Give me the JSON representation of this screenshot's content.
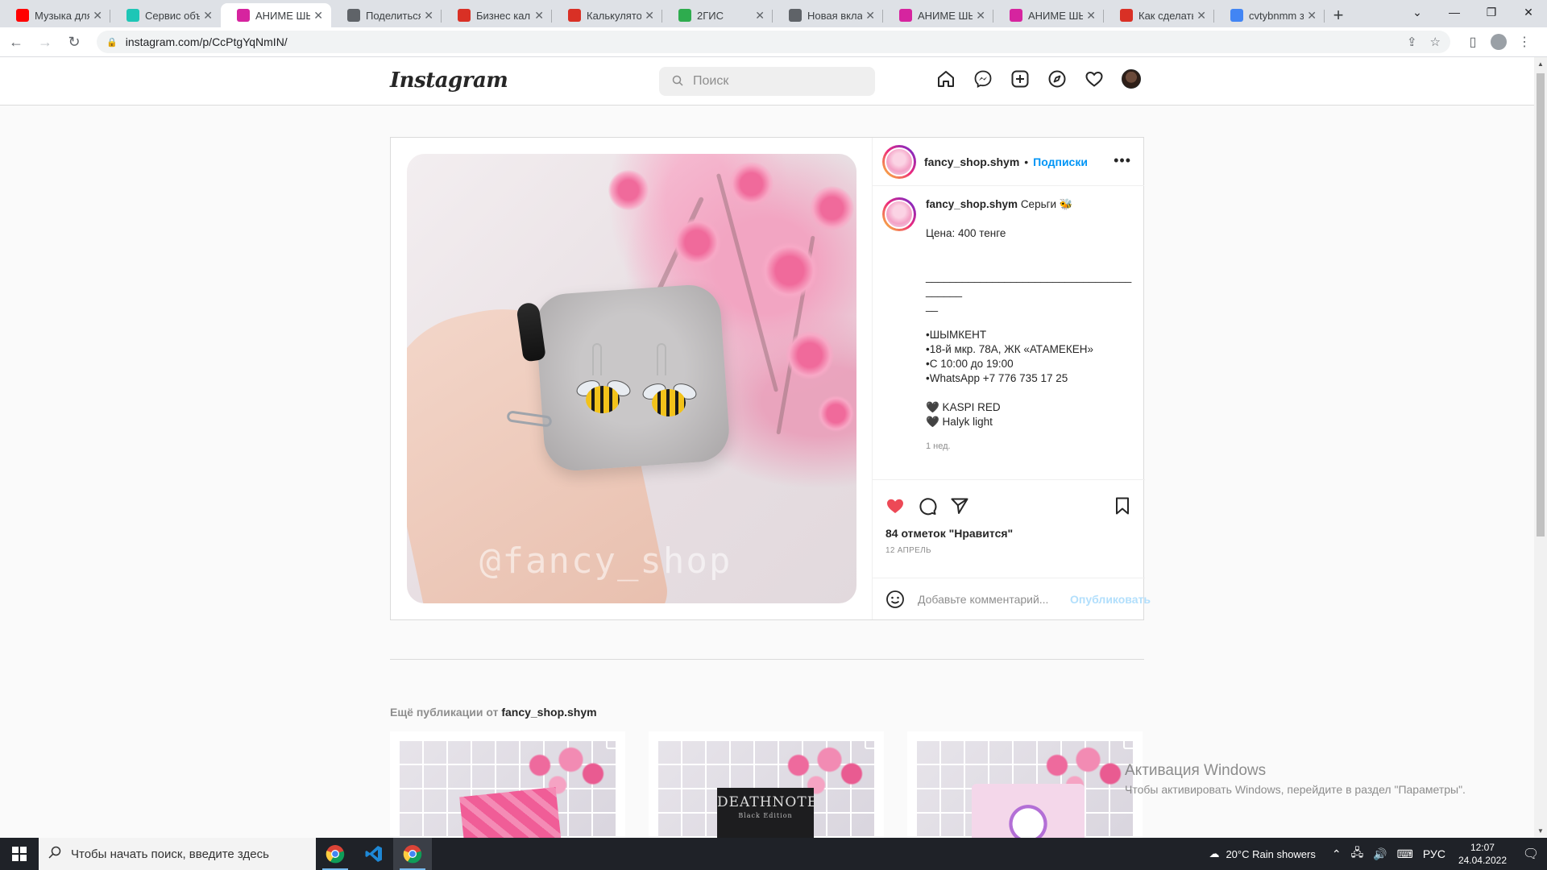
{
  "browser": {
    "tabs": [
      {
        "label": "Музыка для у",
        "icon": "youtube-icon",
        "color": "#ff0000"
      },
      {
        "label": "Сервис объяв",
        "icon": "service-icon",
        "color": "#1ec6b6"
      },
      {
        "label": "АНИМЕ ШЫМ",
        "icon": "instagram-icon",
        "color": "#d6249f",
        "active": true
      },
      {
        "label": "Поделиться с",
        "icon": "globe-icon",
        "color": "#5f6368"
      },
      {
        "label": "Бизнес кальк",
        "icon": "calculator-icon",
        "color": "#d93025"
      },
      {
        "label": "Калькулятор",
        "icon": "calculator-icon",
        "color": "#d93025"
      },
      {
        "label": "2ГИС",
        "icon": "2gis-icon",
        "color": "#2eac4e"
      },
      {
        "label": "Новая вкладк",
        "icon": "chrome-icon",
        "color": "#5f6368"
      },
      {
        "label": "АНИМЕ ШЫМ",
        "icon": "instagram-icon",
        "color": "#d6249f"
      },
      {
        "label": "АНИМЕ ШЫМ",
        "icon": "instagram-icon",
        "color": "#d6249f"
      },
      {
        "label": "Как сделать с",
        "icon": "bookmark-red-icon",
        "color": "#d93025"
      },
      {
        "label": "cvtybnmm з",
        "icon": "google-icon",
        "color": "#4285f4"
      }
    ],
    "url": "instagram.com/p/CcPtgYqNmIN/"
  },
  "instagram": {
    "logo": "Instagram",
    "search_placeholder": "Поиск",
    "post": {
      "username": "fancy_shop.shym",
      "dot": "•",
      "follow_label": "Подписки",
      "caption_title": "Серьги 🐝",
      "caption_lines": [
        "Цена: 400 тенге",
        "",
        "",
        "________________________________________",
        "__",
        "",
        "•ШЫМКЕНТ",
        "•18-й мкр. 78А, ЖК «АТАМЕКЕН»",
        "•С 10:00 до 19:00",
        "•WhatsApp +7 776 735 17 25",
        "",
        "🖤 KASPI RED",
        "🖤 Halyk light"
      ],
      "caption_time": "1 нед.",
      "likes": "84 отметок \"Нравится\"",
      "date": "12 АПРЕЛЬ",
      "comment_placeholder": "Добавьте комментарий...",
      "publish_label": "Опубликовать",
      "watermark": "@fancy_shop",
      "liked": true
    },
    "more_from_prefix": "Ещё публикации от",
    "more_from_user": "fancy_shop.shym",
    "thumb_book_title": "DEATHNOTE",
    "thumb_book_sub": "Black Edition"
  },
  "windows_activation": {
    "title": "Активация Windows",
    "subtitle": "Чтобы активировать Windows, перейдите в раздел \"Параметры\"."
  },
  "taskbar": {
    "search_placeholder": "Чтобы начать поиск, введите здесь",
    "weather": "20°C  Rain showers",
    "lang": "РУС",
    "time": "12:07",
    "date": "24.04.2022"
  },
  "colors": {
    "like_red": "#ed4956",
    "link_blue": "#0095f6",
    "publish_disabled": "#b2dffc"
  }
}
